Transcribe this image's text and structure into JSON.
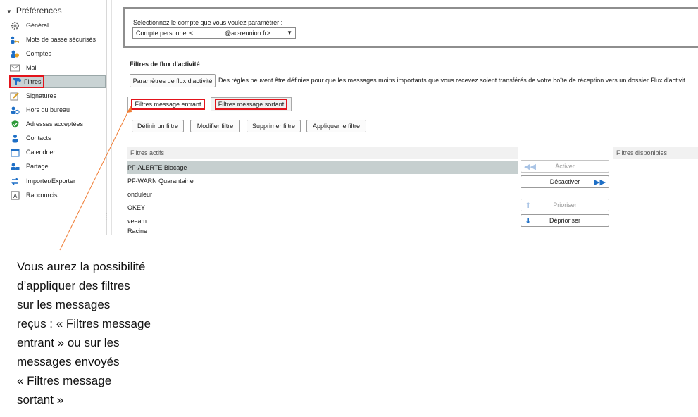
{
  "sidebar": {
    "root_label": "Préférences",
    "items": [
      {
        "label": "Général",
        "icon": "gear-icon"
      },
      {
        "label": "Mots de passe sécurisés",
        "icon": "key-people-icon"
      },
      {
        "label": "Comptes",
        "icon": "accounts-icon"
      },
      {
        "label": "Mail",
        "icon": "mail-icon"
      },
      {
        "label": "Filtres",
        "icon": "filter-icon"
      },
      {
        "label": "Signatures",
        "icon": "signature-icon"
      },
      {
        "label": "Hors du bureau",
        "icon": "out-of-office-icon"
      },
      {
        "label": "Adresses acceptées",
        "icon": "shield-check-icon"
      },
      {
        "label": "Contacts",
        "icon": "contacts-icon"
      },
      {
        "label": "Calendrier",
        "icon": "calendar-icon"
      },
      {
        "label": "Partage",
        "icon": "share-icon"
      },
      {
        "label": "Importer/Exporter",
        "icon": "import-export-icon"
      },
      {
        "label": "Raccourcis",
        "icon": "keyboard-shortcut-icon"
      }
    ],
    "selected_index": 4
  },
  "account": {
    "label": "Sélectionnez le compte que vous voulez paramétrer :",
    "selected_left": "Compte personnel <",
    "selected_right": "@ac-reunion.fr>"
  },
  "activity": {
    "title": "Filtres de flux d'activité",
    "button_label": "Paramètres de flux d'activité",
    "description": "Des règles peuvent être définies pour que les messages moins importants que vous recevez soient transférés de votre boîte de réception vers un dossier Flux d'activit"
  },
  "tabs": [
    {
      "label": "Filtres message entrant",
      "active": true
    },
    {
      "label": "Filtres message sortant",
      "active": false
    }
  ],
  "toolbar": {
    "define": "Définir un filtre",
    "modify": "Modifier filtre",
    "delete": "Supprimer filtre",
    "apply": "Appliquer le filtre"
  },
  "active_filters": {
    "header": "Filtres actifs",
    "rows": [
      "PF-ALERTE Blocage",
      "PF-WARN Quarantaine",
      "onduleur",
      "OKEY",
      "veeam",
      "Racine"
    ],
    "selected_index": 0
  },
  "available_filters": {
    "header": "Filtres disponibles"
  },
  "actions": {
    "activate": "Activer",
    "deactivate": "Désactiver",
    "prioritize": "Prioriser",
    "deprioritize": "Déprioriser"
  },
  "annotation": {
    "lines": [
      "Vous aurez la possibilité",
      "d’appliquer des filtres",
      "sur les messages",
      "reçus : « Filtres message",
      "entrant » ou sur les",
      "messages envoyés",
      "« Filtres message",
      "sortant »"
    ]
  },
  "colors": {
    "highlight_red": "#e3131b",
    "selection": "#c6cfcf",
    "arrow": "#f07d35",
    "icon_blue": "#1e6fc6"
  }
}
